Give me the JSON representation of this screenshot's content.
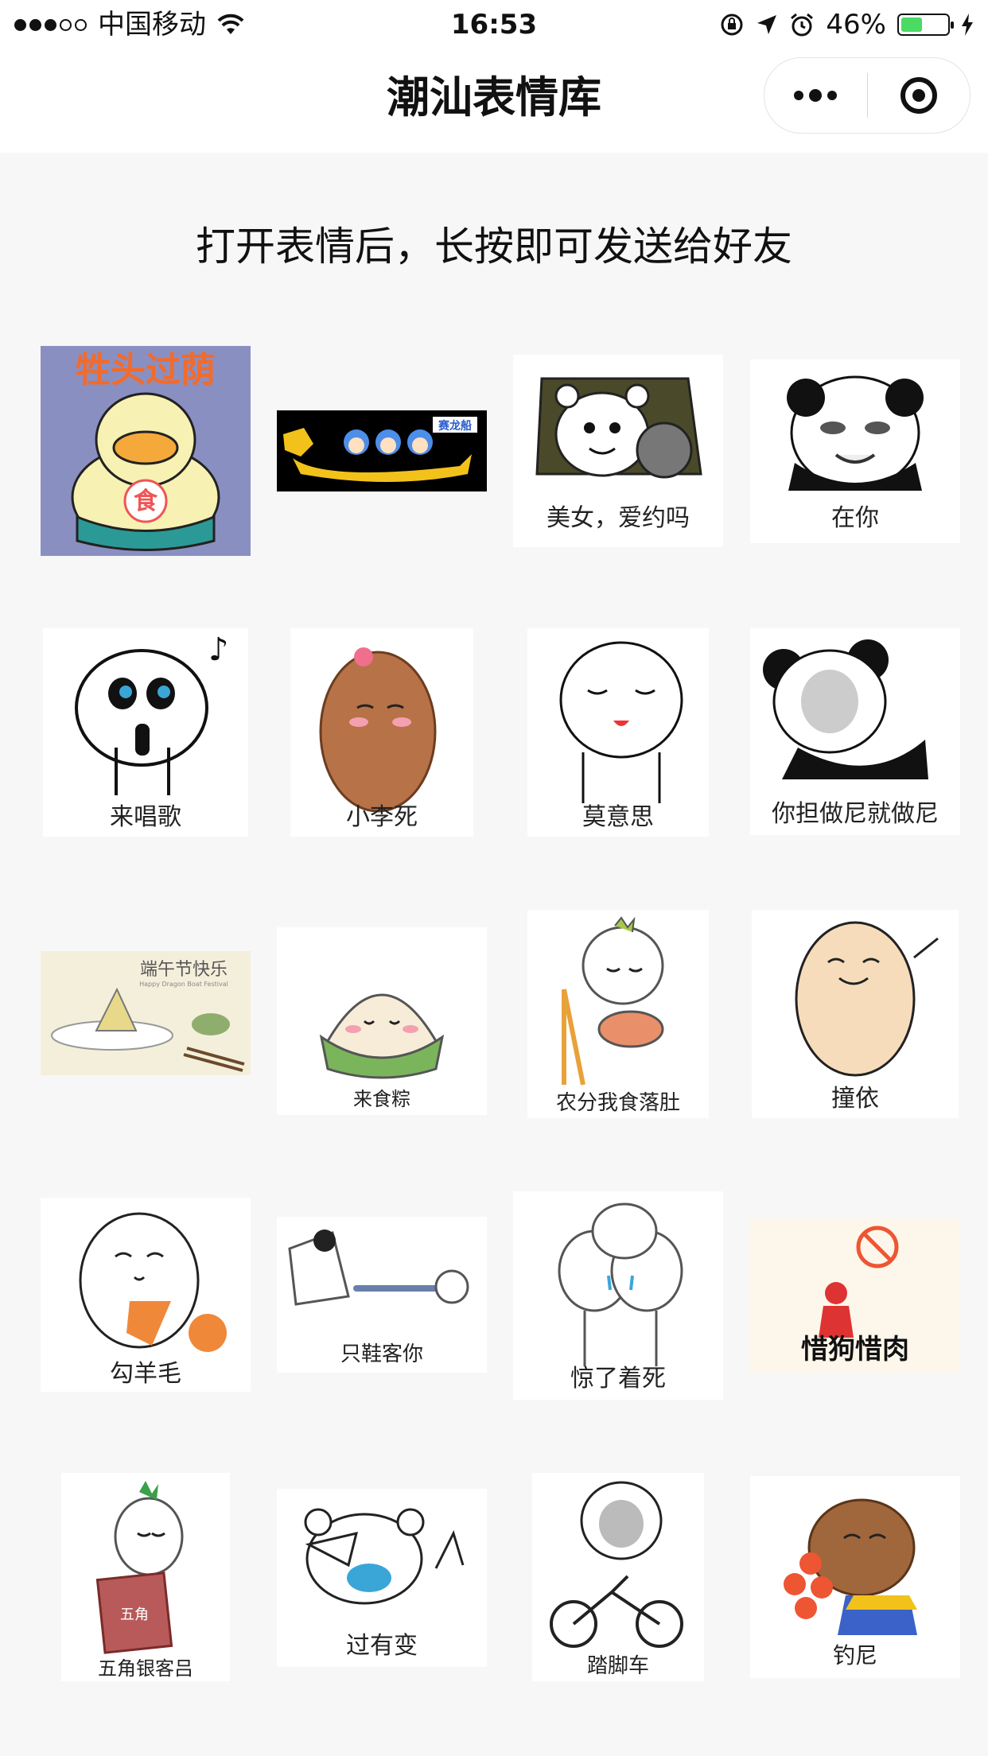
{
  "status_bar": {
    "carrier": "中国移动",
    "time": "16:53",
    "battery_percent": "46%",
    "battery_level": 0.46,
    "icons": [
      "signal-dots",
      "wifi-icon",
      "orientation-lock-icon",
      "location-arrow-icon",
      "alarm-icon",
      "battery-icon",
      "charging-bolt-icon"
    ]
  },
  "nav": {
    "title": "潮汕表情库",
    "more_icon": "more-dots-icon",
    "close_icon": "target-close-icon"
  },
  "instruction": "打开表情后，长按即可发送给好友",
  "stickers": [
    {
      "caption": "",
      "banner": "牲头过荫",
      "badge": "食"
    },
    {
      "caption": "",
      "banner": "赛龙船"
    },
    {
      "caption": "美女，爱约吗"
    },
    {
      "caption": "在你"
    },
    {
      "caption": "来唱歌"
    },
    {
      "caption": "小李死"
    },
    {
      "caption": "莫意思"
    },
    {
      "caption": "你担做尼就做尼"
    },
    {
      "caption": "",
      "banner": "端午节快乐",
      "subbanner": "Happy Dragon Boat Festival"
    },
    {
      "caption": "来食粽"
    },
    {
      "caption": "农分我食落肚"
    },
    {
      "caption": "撞依"
    },
    {
      "caption": "勾羊毛"
    },
    {
      "caption": "只鞋客你"
    },
    {
      "caption": "惊了着死"
    },
    {
      "caption": "惜狗惜肉"
    },
    {
      "caption": "五角银客吕",
      "badge": "五角"
    },
    {
      "caption": "过有变"
    },
    {
      "caption": "踏脚车"
    },
    {
      "caption": "钓尼"
    }
  ]
}
